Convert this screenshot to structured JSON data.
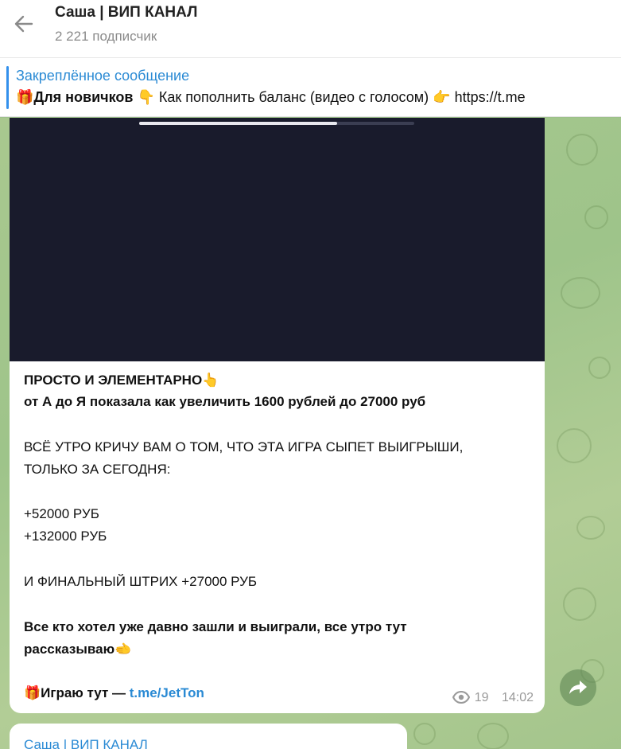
{
  "header": {
    "title": "Саша | ВИП КАНАЛ",
    "subscribers": "2 221 подписчик"
  },
  "pinned": {
    "label": "Закреплённое сообщение",
    "gift": "🎁",
    "bold": "Для новичков",
    "point_down": "👇",
    "text": "Как пополнить баланс (видео с голосом)",
    "point_right": "👉",
    "link": "https://t.me"
  },
  "video": {
    "progress": 0.72
  },
  "message": {
    "line1": "ПРОСТО И ЭЛЕМЕНТАРНО",
    "line1_emoji": "👆",
    "line2": "от А до Я показала как увеличить 1600 рублей до 27000 руб",
    "line3": "ВСЁ УТРО КРИЧУ ВАМ О ТОМ, ЧТО ЭТА ИГРА СЫПЕТ ВЫИГРЫШИ,",
    "line4": "ТОЛЬКО ЗА СЕГОДНЯ:",
    "line5": "+52000 РУБ",
    "line6": "+132000 РУБ",
    "line7": "И ФИНАЛЬНЫЙ ШТРИХ +27000 РУБ",
    "line8": "Все кто хотел уже давно зашли и выиграли, все утро тут",
    "line9": "рассказываю",
    "line9_emoji": "🫲",
    "play_emoji": "🎁",
    "play_text": "Играю тут — ",
    "play_link": "t.me/JetTon",
    "views": "19",
    "time": "14:02"
  },
  "next_message": {
    "name": "Саша | ВИП КАНАЛ"
  },
  "colors": {
    "accent": "#2a8ad4",
    "video_bg": "#191b2c"
  }
}
